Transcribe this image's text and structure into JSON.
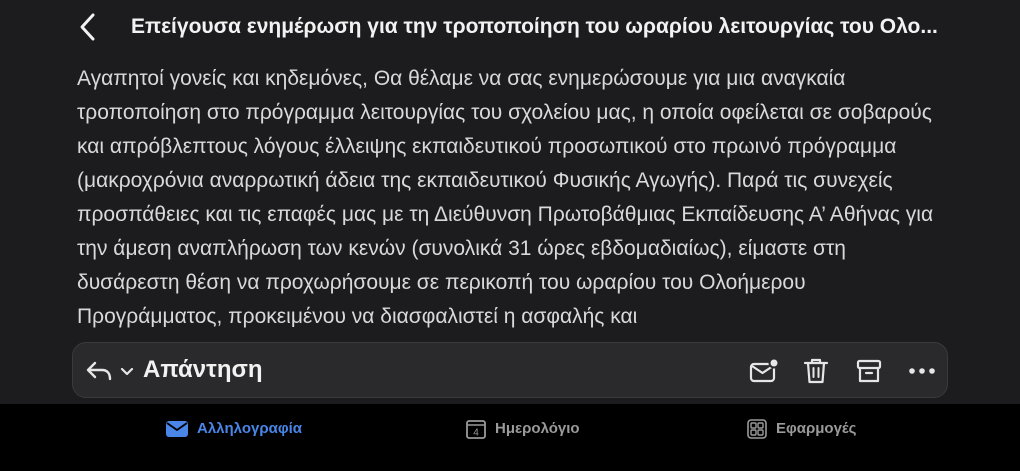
{
  "header": {
    "title": "Επείγουσα ενημέρωση για την τροποποίηση του ωραρίου λειτουργίας του Ολο..."
  },
  "message": {
    "body": "Αγαπητοί γονείς και κηδεμόνες, Θα θέλαμε να σας ενημερώσουμε για μια αναγκαία τροποποίηση στο πρόγραμμα λειτουργίας του σχολείου μας, η οποία οφείλεται σε σοβαρούς και απρόβλεπτους λόγους έλλειψης εκπαιδευτικού προσωπικού στο πρωινό πρόγραμμα (μακροχρόνια αναρρωτική άδεια της εκπαιδευτικού Φυσικής Αγωγής). Παρά τις συνεχείς προσπάθειες και τις επαφές μας με τη Διεύθυνση Πρωτοβάθμιας Εκπαίδευσης Α’ Αθήνας για την άμεση αναπλήρωση των κενών (συνολικά 31 ώρες εβδομαδιαίως), είμαστε στη δυσάρεστη θέση να προχωρήσουμε σε περικοπή του ωραρίου του Ολοήμερου Προγράμματος, προκειμένου να διασφαλιστεί η ασφαλής και"
  },
  "reply_bar": {
    "reply_label": "Απάντηση",
    "icons": [
      "reply-icon",
      "chevron-down-icon",
      "mark-unread-icon",
      "trash-icon",
      "archive-icon",
      "more-icon"
    ]
  },
  "tabs": {
    "mail": "Αλληλογραφία",
    "calendar": "Ημερολόγιο",
    "calendar_day": "4",
    "apps": "Εφαρμογές"
  },
  "colors": {
    "accent": "#4a86e8",
    "background": "#000000",
    "surface": "#1c1c1e"
  }
}
